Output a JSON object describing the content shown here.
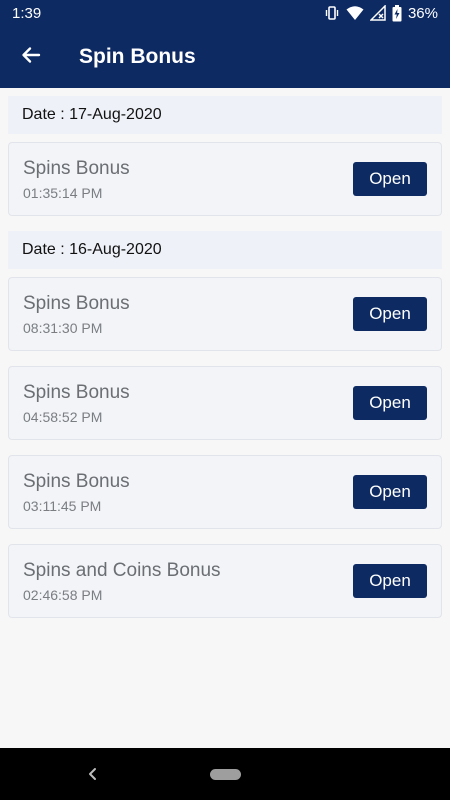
{
  "status": {
    "time": "1:39",
    "battery": "36%"
  },
  "appbar": {
    "title": "Spin Bonus"
  },
  "groups": [
    {
      "date": "Date : 17-Aug-2020",
      "items": [
        {
          "name": "Spins Bonus",
          "time": "01:35:14 PM",
          "button": "Open"
        }
      ]
    },
    {
      "date": "Date : 16-Aug-2020",
      "items": [
        {
          "name": "Spins Bonus",
          "time": "08:31:30 PM",
          "button": "Open"
        },
        {
          "name": "Spins Bonus",
          "time": "04:58:52 PM",
          "button": "Open"
        },
        {
          "name": "Spins Bonus",
          "time": "03:11:45 PM",
          "button": "Open"
        },
        {
          "name": "Spins and Coins Bonus",
          "time": "02:46:58 PM",
          "button": "Open"
        }
      ]
    }
  ],
  "icons": {
    "back": "arrow-left-icon",
    "vibrate": "vibrate-icon",
    "wifi": "wifi-icon",
    "signal": "signal-icon",
    "battery": "battery-charging-icon",
    "nav_back": "nav-back-icon",
    "nav_home": "nav-home-pill"
  },
  "colors": {
    "primary": "#0d2a63",
    "background": "#f7f7f8",
    "card": "#f2f4f8"
  }
}
